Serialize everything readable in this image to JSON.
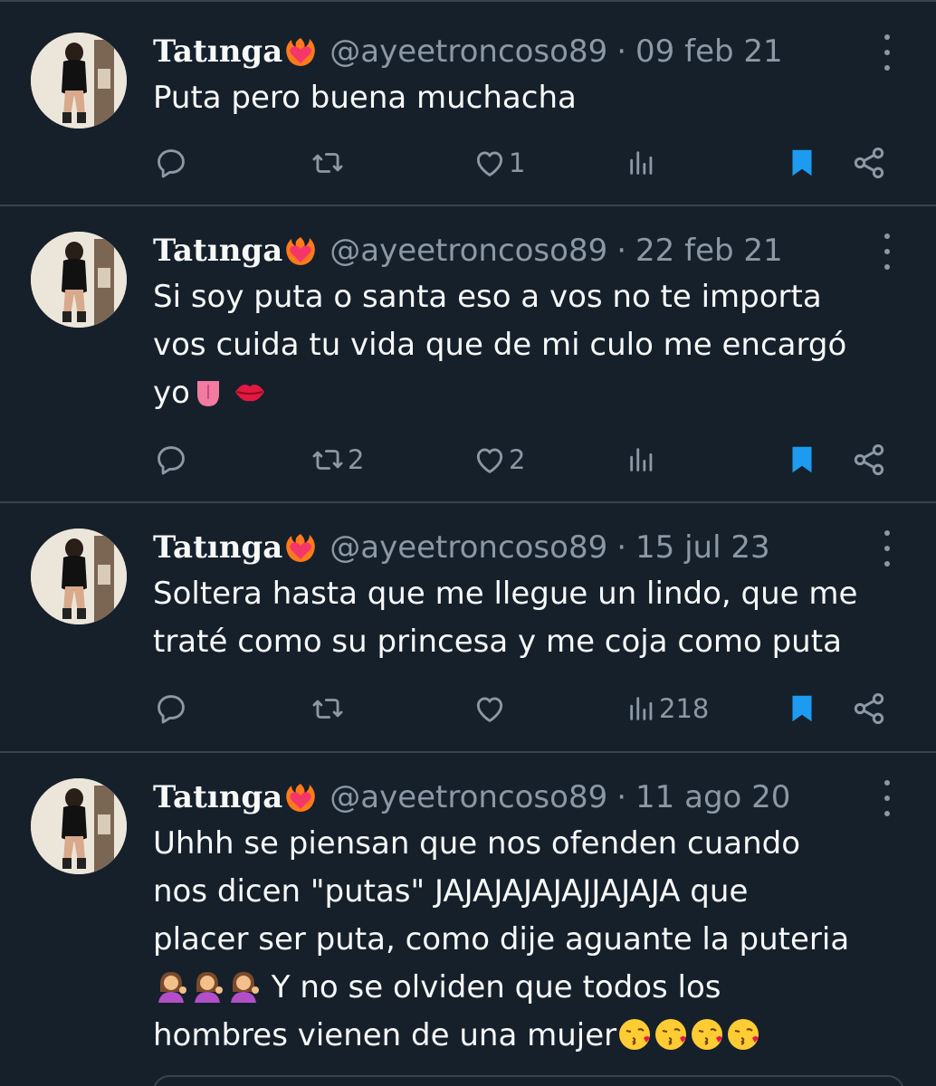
{
  "tweets": [
    {
      "name": "Tatınga",
      "handle": "@ayeetroncoso89",
      "separator": "·",
      "date": "09 feb 21",
      "text_lines": [
        "Puta pero buena muchacha"
      ],
      "trailing_emojis": [],
      "retweets": "",
      "likes": "1",
      "views": "",
      "bookmarked": true
    },
    {
      "name": "Tatınga",
      "handle": "@ayeetroncoso89",
      "separator": "·",
      "date": "22 feb 21",
      "text_lines": [
        "Si soy puta o santa eso a vos no te importa",
        "vos cuida tu vida que de mi culo me encargó",
        "yo"
      ],
      "trailing_emojis": [
        "tongue-emoji",
        "lips-emoji"
      ],
      "retweets": "2",
      "likes": "2",
      "views": "",
      "bookmarked": true
    },
    {
      "name": "Tatınga",
      "handle": "@ayeetroncoso89",
      "separator": "·",
      "date": "15 jul 23",
      "text_lines": [
        "Soltera hasta que me llegue un lindo, que me",
        "traté como su princesa y me coja como puta"
      ],
      "trailing_emojis": [],
      "retweets": "",
      "likes": "",
      "views": "218",
      "bookmarked": true
    },
    {
      "name": "Tatınga",
      "handle": "@ayeetroncoso89",
      "separator": "·",
      "date": "11 ago 20",
      "text_lines": [
        "Uhhh se piensan que nos ofenden cuando",
        "nos dicen \"putas\" JAJAJAJAJAJJAJAJA que",
        "placer ser puta, como dije aguante la puteria"
      ],
      "line4_text": " Y no se olviden que todos los",
      "line5_text": "hombres vienen de una mujer",
      "line4_emojis": [
        "woman-tipping-hand-emoji",
        "woman-tipping-hand-emoji",
        "woman-tipping-hand-emoji"
      ],
      "line5_emojis": [
        "kissing-face-emoji",
        "kissing-face-emoji",
        "kissing-face-emoji",
        "kissing-face-emoji"
      ]
    }
  ],
  "colors": {
    "background": "#15202b",
    "divider": "#38444d",
    "primary_text": "#f7f9f9",
    "secondary_text": "#8b98a5",
    "bookmark_accent": "#1d9bf0"
  },
  "icons": {
    "name_badge": "heart-on-fire-emoji",
    "reply": "reply-icon",
    "retweet": "retweet-icon",
    "like": "heart-icon",
    "views": "views-icon",
    "bookmark": "bookmark-icon",
    "share": "share-icon",
    "more": "more-icon"
  }
}
